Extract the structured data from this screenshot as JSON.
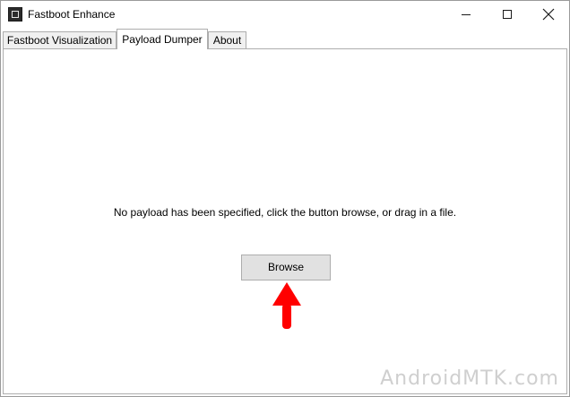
{
  "window": {
    "title": "Fastboot Enhance"
  },
  "tabs": [
    {
      "label": "Fastboot Visualization",
      "active": false
    },
    {
      "label": "Payload Dumper",
      "active": true
    },
    {
      "label": "About",
      "active": false
    }
  ],
  "payload_dumper": {
    "message": "No payload has been specified, click the button browse, or drag in a file.",
    "browse_label": "Browse"
  },
  "annotation": {
    "arrow_color": "#ff0000"
  },
  "watermark": "AndroidMTK.com"
}
